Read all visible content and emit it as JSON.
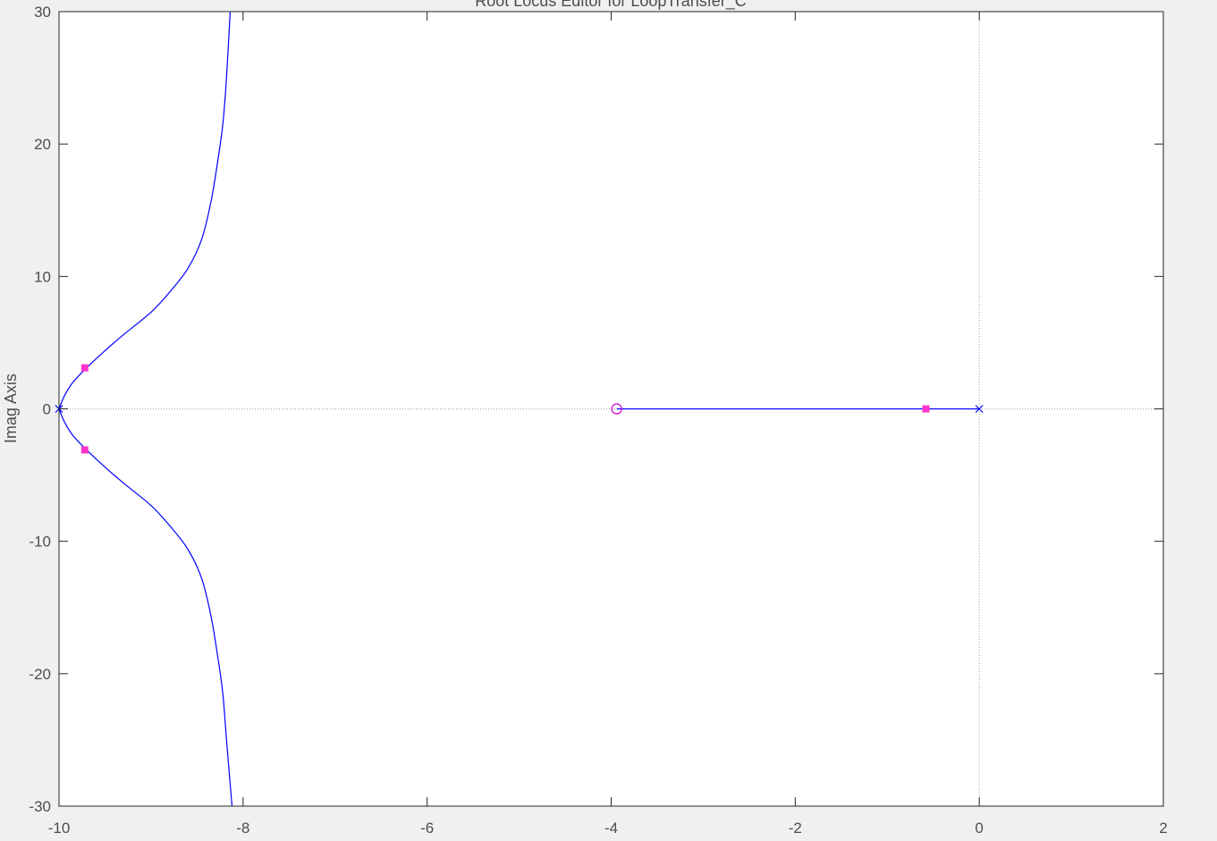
{
  "chart_data": {
    "type": "root-locus",
    "title": "Root Locus Editor for LoopTransfer_C",
    "xlabel": "",
    "ylabel": "Imag Axis",
    "xlim": [
      -10,
      2
    ],
    "ylim": [
      -30,
      30
    ],
    "xticks": [
      -10,
      -8,
      -6,
      -4,
      -2,
      0,
      2
    ],
    "yticks": [
      -30,
      -20,
      -10,
      0,
      10,
      20,
      30
    ],
    "grid": false,
    "reference_lines": {
      "real_axis": 0,
      "imag_axis": 0
    },
    "colors": {
      "locus": "#0000ff",
      "pole": "#0000ff",
      "zero": "#cc00cc",
      "closed_loop_pole": "#ff33cc",
      "axes_box": "#262626",
      "reference_line": "#a0a0a0",
      "background": "#ffffff",
      "figure_background": "#f0f0f0"
    },
    "branches": [
      {
        "name": "upper-branch",
        "points": [
          [
            -10,
            0
          ],
          [
            -9.94,
            1.0
          ],
          [
            -9.85,
            2.0
          ],
          [
            -9.7,
            3.1
          ],
          [
            -9.5,
            4.4
          ],
          [
            -9.3,
            5.6
          ],
          [
            -9.0,
            7.3
          ],
          [
            -8.8,
            8.8
          ],
          [
            -8.6,
            10.6
          ],
          [
            -8.45,
            12.8
          ],
          [
            -8.35,
            15.6
          ],
          [
            -8.28,
            18.5
          ],
          [
            -8.22,
            21.5
          ],
          [
            -8.18,
            25.0
          ],
          [
            -8.14,
            30.0
          ]
        ]
      },
      {
        "name": "lower-branch",
        "points": [
          [
            -10,
            0
          ],
          [
            -9.94,
            -1.0
          ],
          [
            -9.85,
            -2.0
          ],
          [
            -9.7,
            -3.1
          ],
          [
            -9.5,
            -4.4
          ],
          [
            -9.3,
            -5.6
          ],
          [
            -9.0,
            -7.3
          ],
          [
            -8.8,
            -8.8
          ],
          [
            -8.6,
            -10.6
          ],
          [
            -8.45,
            -12.8
          ],
          [
            -8.35,
            -15.6
          ],
          [
            -8.28,
            -18.5
          ],
          [
            -8.22,
            -21.5
          ],
          [
            -8.18,
            -25.0
          ],
          [
            -8.12,
            -30.0
          ]
        ]
      },
      {
        "name": "real-axis-branch",
        "points": [
          [
            -3.94,
            0
          ],
          [
            0,
            0
          ]
        ]
      }
    ],
    "open_loop_poles": [
      [
        -10,
        0
      ],
      [
        0,
        0
      ]
    ],
    "open_loop_zeros": [
      [
        -3.94,
        0
      ]
    ],
    "closed_loop_poles": [
      [
        -9.72,
        3.1
      ],
      [
        -9.72,
        -3.1
      ],
      [
        -0.58,
        0
      ]
    ]
  }
}
